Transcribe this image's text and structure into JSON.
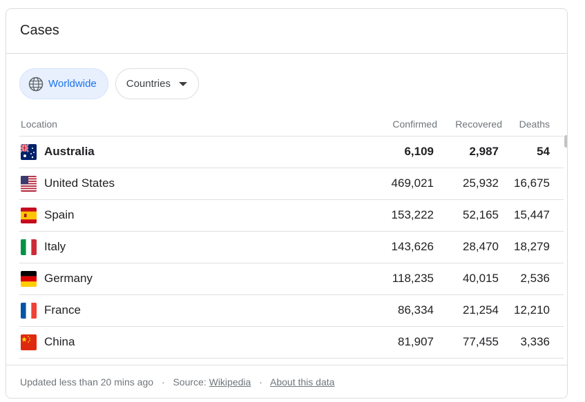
{
  "card": {
    "title": "Cases"
  },
  "filters": {
    "worldwide": "Worldwide",
    "countries": "Countries"
  },
  "table": {
    "headers": {
      "location": "Location",
      "confirmed": "Confirmed",
      "recovered": "Recovered",
      "deaths": "Deaths"
    },
    "rows": [
      {
        "country": "Australia",
        "confirmed": "6,109",
        "recovered": "2,987",
        "deaths": "54",
        "flag": "au"
      },
      {
        "country": "United States",
        "confirmed": "469,021",
        "recovered": "25,932",
        "deaths": "16,675",
        "flag": "us"
      },
      {
        "country": "Spain",
        "confirmed": "153,222",
        "recovered": "52,165",
        "deaths": "15,447",
        "flag": "es"
      },
      {
        "country": "Italy",
        "confirmed": "143,626",
        "recovered": "28,470",
        "deaths": "18,279",
        "flag": "it"
      },
      {
        "country": "Germany",
        "confirmed": "118,235",
        "recovered": "40,015",
        "deaths": "2,536",
        "flag": "de"
      },
      {
        "country": "France",
        "confirmed": "86,334",
        "recovered": "21,254",
        "deaths": "12,210",
        "flag": "fr"
      },
      {
        "country": "China",
        "confirmed": "81,907",
        "recovered": "77,455",
        "deaths": "3,336",
        "flag": "cn"
      }
    ]
  },
  "footer": {
    "updated": "Updated less than 20 mins ago",
    "separator": "·",
    "source_label": "Source:",
    "source_link": "Wikipedia",
    "about_link": "About this data"
  },
  "colors": {
    "accent": "#1a73e8",
    "chip_bg": "#e8f0fe",
    "border": "#dadce0"
  }
}
